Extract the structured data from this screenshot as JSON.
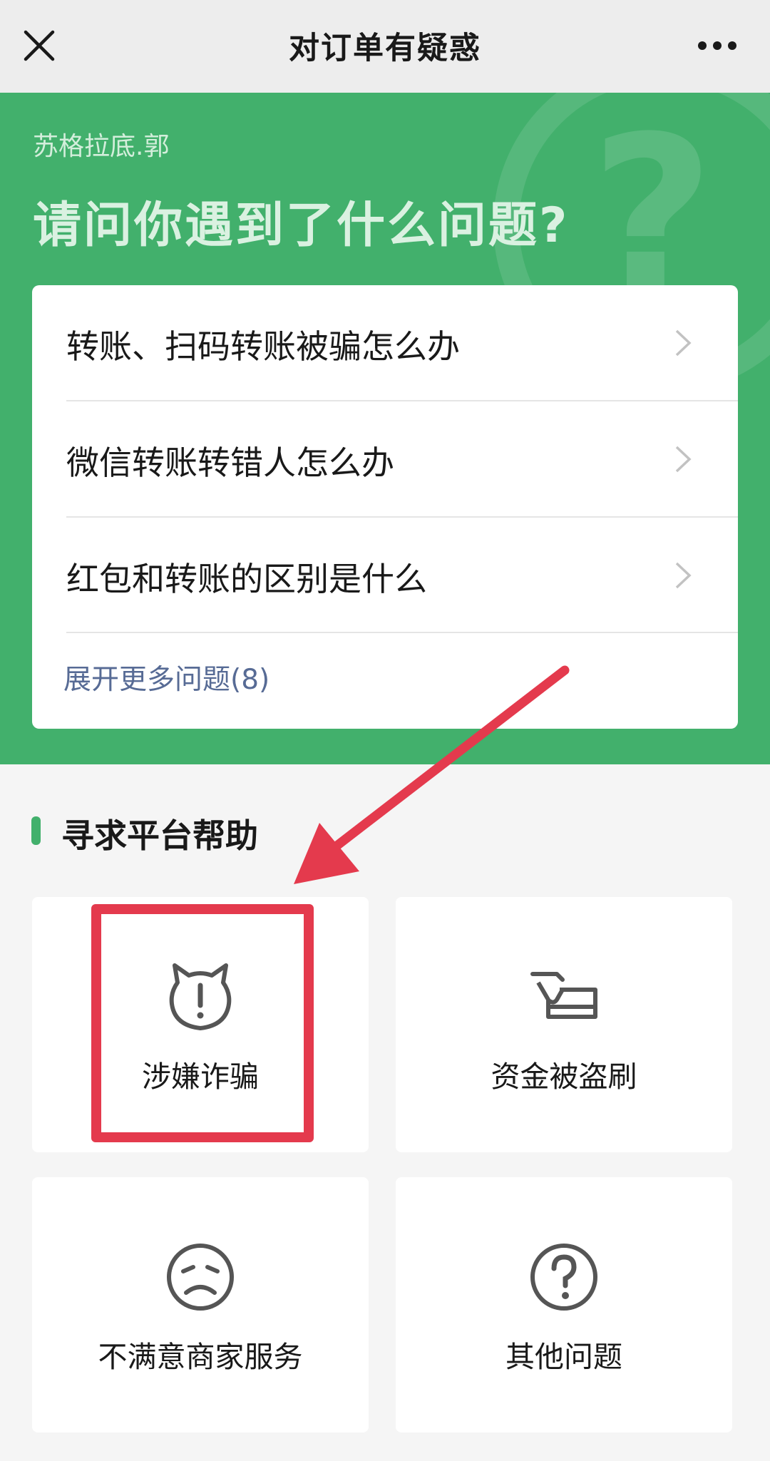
{
  "nav": {
    "title": "对订单有疑惑",
    "close_icon": "close-icon",
    "more_icon": "more-horizontal-icon"
  },
  "hero": {
    "user_name": "苏格拉底.郭",
    "title": "请问你遇到了什么问题?",
    "background_color": "#42b06c"
  },
  "faq": {
    "items": [
      {
        "label": "转账、扫码转账被骗怎么办"
      },
      {
        "label": "微信转账转错人怎么办"
      },
      {
        "label": "红包和转账的区别是什么"
      }
    ],
    "more_label": "展开更多问题(8)"
  },
  "help": {
    "section_title": "寻求平台帮助",
    "tiles": [
      {
        "label": "涉嫌诈骗",
        "icon": "devil-warning-icon"
      },
      {
        "label": "资金被盗刷",
        "icon": "card-swipe-icon"
      },
      {
        "label": "不满意商家服务",
        "icon": "sad-face-icon"
      },
      {
        "label": "其他问题",
        "icon": "question-circle-icon"
      }
    ]
  },
  "annotation": {
    "highlight_color": "#e43a4d"
  }
}
